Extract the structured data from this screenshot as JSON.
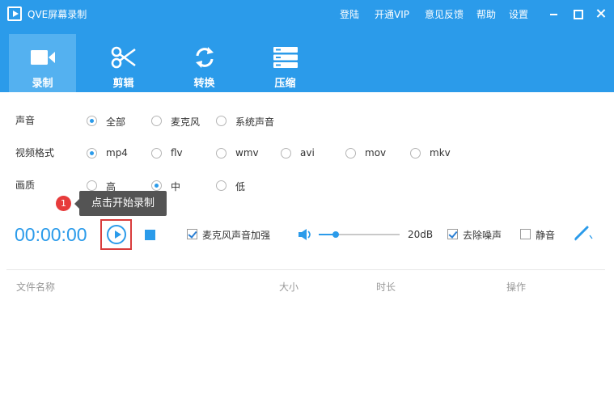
{
  "app": {
    "title": "QVE屏幕录制"
  },
  "title_links": [
    "登陆",
    "开通VIP",
    "意见反馈",
    "帮助",
    "设置"
  ],
  "toolbar": {
    "tabs": [
      {
        "label": "录制",
        "icon": "video-camera-icon",
        "active": true
      },
      {
        "label": "剪辑",
        "icon": "scissors-icon",
        "active": false
      },
      {
        "label": "转换",
        "icon": "convert-icon",
        "active": false
      },
      {
        "label": "压缩",
        "icon": "compress-icon",
        "active": false
      }
    ]
  },
  "options": {
    "audio": {
      "label": "声音",
      "choices": [
        "全部",
        "麦克风",
        "系统声音"
      ],
      "selected": "全部"
    },
    "format": {
      "label": "视频格式",
      "choices": [
        "mp4",
        "flv",
        "wmv",
        "avi",
        "mov",
        "mkv"
      ],
      "selected": "mp4"
    },
    "quality": {
      "label": "画质",
      "choices": [
        "高",
        "中",
        "低"
      ],
      "selected": "中"
    }
  },
  "tooltip": {
    "badge": "1",
    "text": "点击开始录制"
  },
  "controls": {
    "timer": "00:00:00",
    "mic_boost": {
      "label": "麦克风声音加强",
      "checked": true
    },
    "volume": {
      "value_label": "20dB",
      "level": 0.21
    },
    "noise_removal": {
      "label": "去除噪声",
      "checked": true
    },
    "mute": {
      "label": "静音",
      "checked": false
    }
  },
  "file_list": {
    "columns": [
      "文件名称",
      "大小",
      "时长",
      "操作"
    ],
    "rows": []
  },
  "colors": {
    "accent": "#2b9bea",
    "active_tab": "#54b1f0",
    "highlight": "#d93c3c",
    "tooltip_bg": "#545454",
    "badge": "#e73b3b"
  }
}
